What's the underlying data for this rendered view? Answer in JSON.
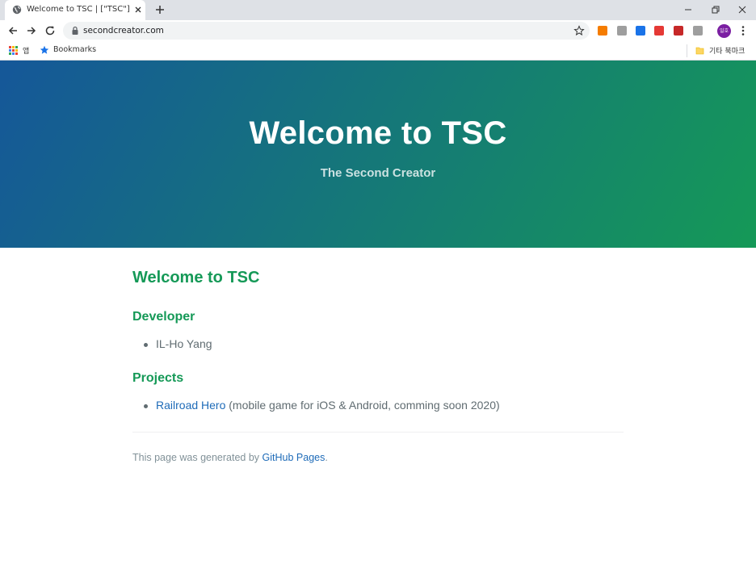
{
  "browser": {
    "tab_title": "Welcome to TSC | [\"TSC\"]",
    "url": "secondcreator.com",
    "avatar_text": "일호",
    "bookmarks": {
      "apps_label": "앱",
      "bookmarks_label": "Bookmarks",
      "other_label": "기타 북마크"
    },
    "extensions": [
      {
        "name": "rx-extension-icon",
        "color": "#f57c00"
      },
      {
        "name": "image-extension-icon",
        "color": "#9e9e9e"
      },
      {
        "name": "lock-extension-icon",
        "color": "#1a73e8"
      },
      {
        "name": "youtube-extension-icon",
        "color": "#e53935"
      },
      {
        "name": "pdf-extension-icon",
        "color": "#c62828"
      },
      {
        "name": "circle-extension-icon",
        "color": "#9e9e9e"
      }
    ]
  },
  "page": {
    "header": {
      "title": "Welcome to TSC",
      "tagline": "The Second Creator"
    },
    "content": {
      "heading": "Welcome to TSC",
      "developer_heading": "Developer",
      "developer_name": "IL-Ho Yang",
      "projects_heading": "Projects",
      "project_link": "Railroad Hero",
      "project_desc": " (mobile game for iOS & Android, comming soon 2020)"
    },
    "footer": {
      "prefix": "This page was generated by ",
      "link": "GitHub Pages",
      "suffix": "."
    }
  },
  "colors": {
    "gradient_start": "#155799",
    "gradient_end": "#159957",
    "heading": "#159957",
    "link": "#1e6bb8",
    "text": "#606c71"
  }
}
